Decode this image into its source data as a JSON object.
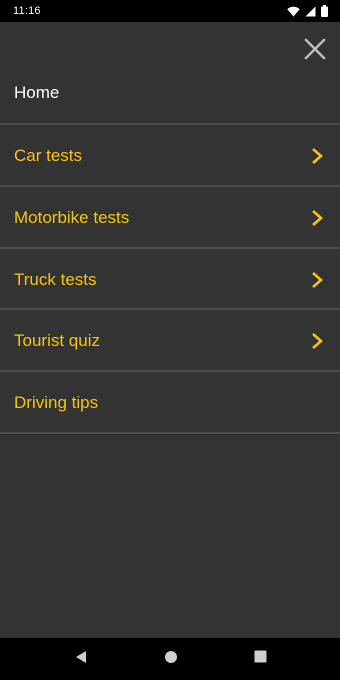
{
  "status_bar": {
    "time": "11:16",
    "icons": [
      "wifi-icon",
      "signal-icon",
      "battery-icon"
    ]
  },
  "drawer": {
    "close_icon": "close-icon",
    "accent_color": "#f6c416",
    "home_label": "Home",
    "items": [
      {
        "label": "Car tests",
        "has_chevron": true
      },
      {
        "label": "Motorbike tests",
        "has_chevron": true
      },
      {
        "label": "Truck tests",
        "has_chevron": true
      },
      {
        "label": "Tourist quiz",
        "has_chevron": true
      },
      {
        "label": "Driving tips",
        "has_chevron": false
      }
    ]
  },
  "nav_bar": {
    "icons": [
      "back-icon",
      "home-icon",
      "recents-icon"
    ]
  }
}
